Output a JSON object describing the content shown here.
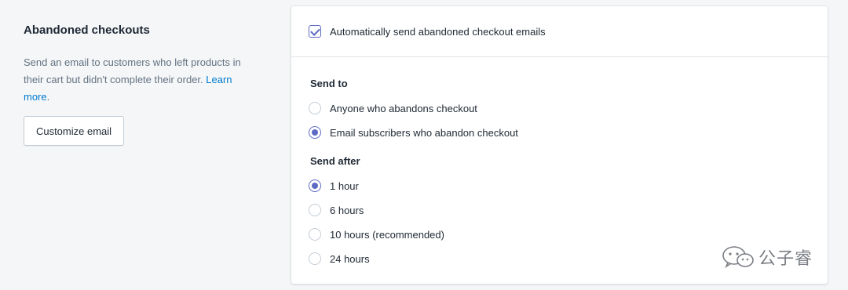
{
  "left": {
    "title": "Abandoned checkouts",
    "description": "Send an email to customers who left products in their cart but didn't complete their order.",
    "learn_more": "Learn more",
    "learn_more_suffix": ".",
    "customize_button": "Customize email"
  },
  "card": {
    "auto_send_label": "Automatically send abandoned checkout emails",
    "auto_send_checked": true,
    "send_to": {
      "title": "Send to",
      "options": [
        {
          "label": "Anyone who abandons checkout",
          "selected": false
        },
        {
          "label": "Email subscribers who abandon checkout",
          "selected": true
        }
      ]
    },
    "send_after": {
      "title": "Send after",
      "options": [
        {
          "label": "1 hour",
          "selected": true
        },
        {
          "label": "6 hours",
          "selected": false
        },
        {
          "label": "10 hours (recommended)",
          "selected": false
        },
        {
          "label": "24 hours",
          "selected": false
        }
      ]
    }
  },
  "watermark": {
    "text": "公子睿",
    "icon": "wechat-icon"
  },
  "colors": {
    "accent": "#5c6ac4",
    "link": "#007ace",
    "background": "#f4f6f8"
  }
}
